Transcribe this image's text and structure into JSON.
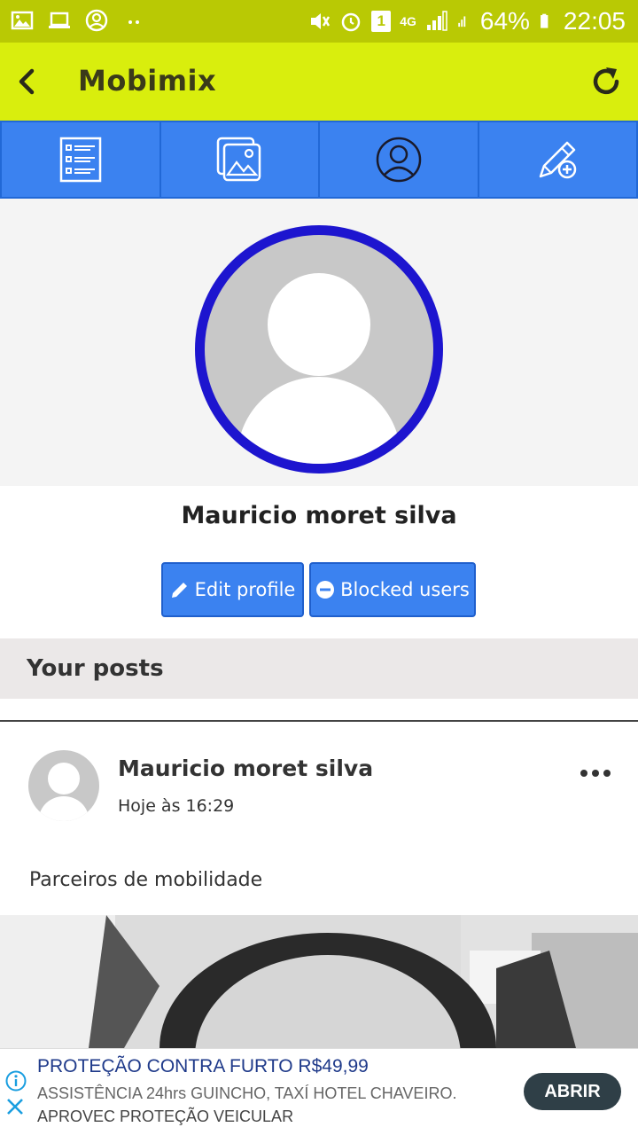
{
  "status_bar": {
    "battery": "64%",
    "time": "22:05",
    "network": "4G",
    "sim_slot": "1"
  },
  "app_bar": {
    "title": "Mobimix",
    "back_icon": "arrow-left-icon",
    "refresh_icon": "refresh-icon"
  },
  "tabs": [
    {
      "name": "feed",
      "icon": "list-icon"
    },
    {
      "name": "gallery",
      "icon": "image-icon"
    },
    {
      "name": "profile",
      "icon": "user-circle-icon"
    },
    {
      "name": "new-post",
      "icon": "pencil-plus-icon"
    }
  ],
  "profile": {
    "name": "Mauricio moret silva",
    "edit_label": "Edit profile",
    "blocked_label": "Blocked users"
  },
  "section": {
    "title": "Your posts"
  },
  "post": {
    "author": "Mauricio moret silva",
    "time": "Hoje às 16:29",
    "text": "Parceiros de mobilidade"
  },
  "ad": {
    "headline": "PROTEÇÃO CONTRA FURTO R$49,99",
    "line1": "ASSISTÊNCIA 24hrs GUINCHO, TAXÍ HOTEL CHAVEIRO.",
    "line2": "APROVEC PROTEÇÃO VEICULAR",
    "cta": "ABRIR"
  },
  "colors": {
    "status_bar": "#b9c904",
    "app_bar": "#d9ee0d",
    "tab_bar": "#3b82f0",
    "avatar_ring": "#1d15cf",
    "button": "#3b82f0"
  }
}
